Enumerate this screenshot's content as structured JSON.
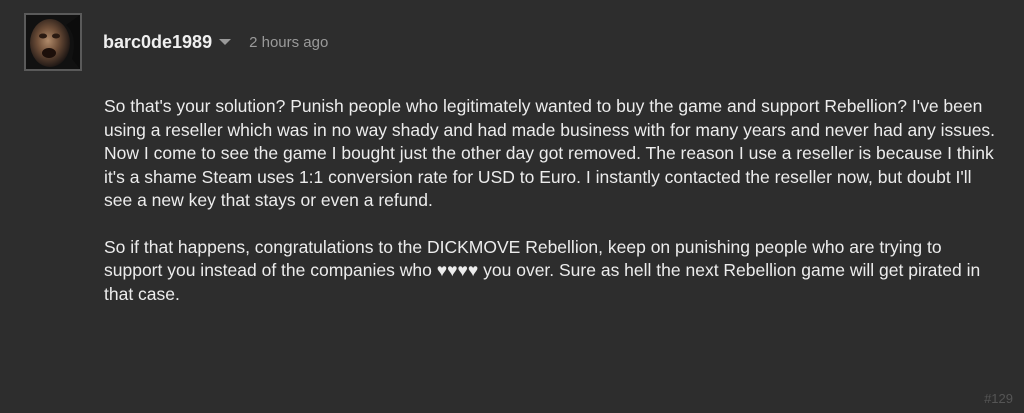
{
  "comment": {
    "author": "barc0de1989",
    "timestamp": "2 hours ago",
    "paragraphs": [
      "So that's your solution? Punish people who legitimately wanted to buy the game and support Rebellion? I've been using a reseller which was in no way shady and had made business with for many years and never had any issues. Now I come to see the game I bought just the other day got removed. The reason I use a reseller is because I think it's a shame Steam uses 1:1 conversion rate for USD to Euro. I instantly contacted the reseller now, but doubt I'll see a new key that stays or even a refund.",
      "So if that happens, congratulations to the DICKMOVE Rebellion, keep on punishing people who are trying to support you instead of the companies who ♥♥♥♥ you over. Sure as hell the next Rebellion game will get pirated in that case."
    ],
    "number": "#129",
    "menu_icon": "chevron-down-icon"
  },
  "colors": {
    "background": "#2d2d2d",
    "text": "#ececec",
    "muted": "#9a9a9a",
    "number": "#555555"
  }
}
